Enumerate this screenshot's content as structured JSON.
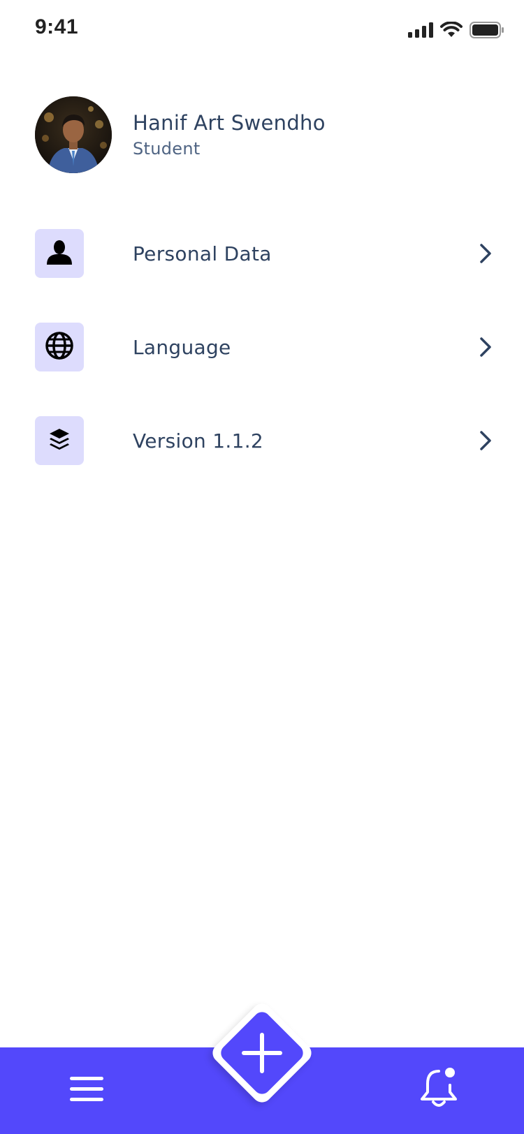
{
  "status_bar": {
    "time": "9:41",
    "icons": [
      "signal-icon",
      "wifi-icon",
      "battery-icon"
    ]
  },
  "profile": {
    "name": "Hanif Art Swendho",
    "role": "Student",
    "avatar_icon": "profile-photo"
  },
  "menu": {
    "items": [
      {
        "label": "Personal Data",
        "icon": "person-icon"
      },
      {
        "label": "Language",
        "icon": "globe-icon"
      },
      {
        "label": "Version 1.1.2",
        "icon": "layers-icon"
      }
    ]
  },
  "bottom_nav": {
    "left_icon": "hamburger-menu-icon",
    "center_icon": "plus-icon",
    "right_icon": "bell-icon"
  },
  "colors": {
    "accent": "#5348fb",
    "icon_tile": "#dddcfd",
    "text_primary": "#2e4260",
    "text_secondary": "#4f6483"
  }
}
